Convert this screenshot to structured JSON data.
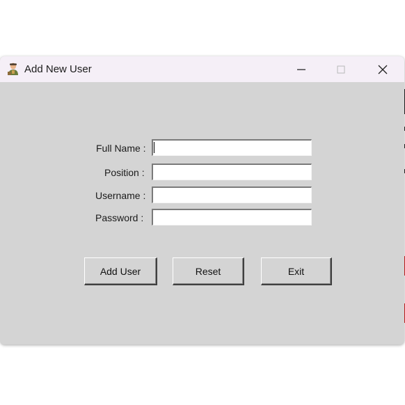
{
  "window": {
    "title": "Add New User",
    "icon": "user-avatar-icon"
  },
  "caption_buttons": {
    "minimize_icon": "minimize-icon",
    "maximize_icon": "maximize-icon",
    "close_icon": "close-icon"
  },
  "form": {
    "full_name": {
      "label": "Full Name :",
      "value": ""
    },
    "position": {
      "label": "Position :",
      "value": ""
    },
    "username": {
      "label": "Username :",
      "value": ""
    },
    "password": {
      "label": "Password :",
      "value": ""
    }
  },
  "buttons": {
    "add_user": "Add User",
    "reset": "Reset",
    "exit": "Exit"
  },
  "colors": {
    "window_bg": "#d4d4d4",
    "titlebar_bg": "#f5eff7",
    "field_bg": "#ffffff"
  }
}
